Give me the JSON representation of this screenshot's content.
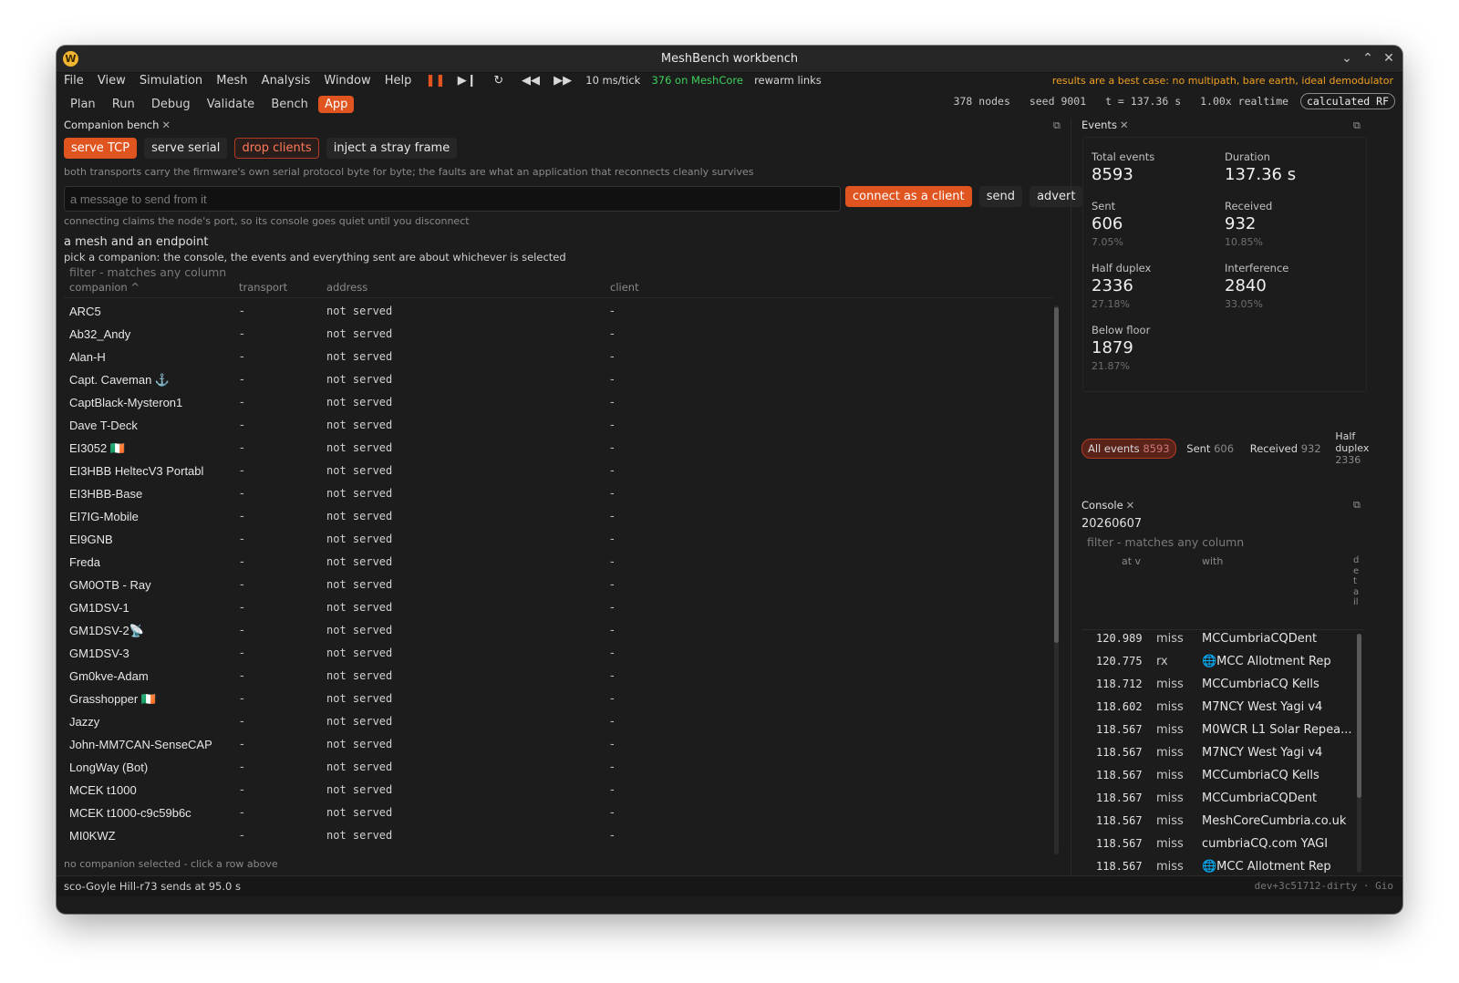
{
  "window": {
    "title": "MeshBench workbench",
    "logo": "W"
  },
  "menu": [
    "File",
    "View",
    "Simulation",
    "Mesh",
    "Analysis",
    "Window",
    "Help"
  ],
  "transport": {
    "tick_rate": "10 ms/tick",
    "mesh_status": "376 on MeshCore",
    "rewarm": "rewarm links",
    "status_color": "#3ecf5a"
  },
  "warning": "results are a best case: no multipath, bare earth, ideal demodulator",
  "tabs": [
    "Plan",
    "Run",
    "Debug",
    "Validate",
    "Bench",
    "App"
  ],
  "active_tab": "App",
  "status": {
    "nodes": "378 nodes",
    "seed": "seed 9001",
    "time": "t = 137.36 s",
    "speed": "1.00x realtime",
    "mode": "calculated RF"
  },
  "companion": {
    "title": "Companion bench",
    "buttons": {
      "serve_tcp": "serve TCP",
      "serve_serial": "serve serial",
      "drop_clients": "drop clients",
      "inject": "inject a stray frame"
    },
    "hint1": "both transports carry the firmware's own serial protocol byte for byte; the faults are what an application that reconnects cleanly survives",
    "message_placeholder": "a message to send from it",
    "connect": "connect as a client",
    "send": "send",
    "advert": "advert",
    "hint2": "connecting claims the node's port, so its console goes quiet until you disconnect",
    "section_title": "a mesh and an endpoint",
    "section_hint": "pick a companion: the console, the events and everything sent are about whichever is selected",
    "filter_placeholder": "filter - matches any column",
    "columns": [
      "companion ^",
      "transport",
      "address",
      "client"
    ],
    "rows": [
      [
        "ARC5",
        "-",
        "not served",
        "-"
      ],
      [
        "Ab32_Andy",
        "-",
        "not served",
        "-"
      ],
      [
        "Alan-H",
        "-",
        "not served",
        "-"
      ],
      [
        "Capt. Caveman ⚓",
        "-",
        "not served",
        "-"
      ],
      [
        "CaptBlack-Mysteron1",
        "-",
        "not served",
        "-"
      ],
      [
        "Dave T-Deck",
        "-",
        "not served",
        "-"
      ],
      [
        "EI3052 🇮🇪",
        "-",
        "not served",
        "-"
      ],
      [
        "EI3HBB HeltecV3 Portabl",
        "-",
        "not served",
        "-"
      ],
      [
        "EI3HBB-Base",
        "-",
        "not served",
        "-"
      ],
      [
        "EI7IG-Mobile",
        "-",
        "not served",
        "-"
      ],
      [
        "EI9GNB",
        "-",
        "not served",
        "-"
      ],
      [
        "Freda",
        "-",
        "not served",
        "-"
      ],
      [
        "GM0OTB - Ray",
        "-",
        "not served",
        "-"
      ],
      [
        "GM1DSV-1",
        "-",
        "not served",
        "-"
      ],
      [
        "GM1DSV-2📡",
        "-",
        "not served",
        "-"
      ],
      [
        "GM1DSV-3",
        "-",
        "not served",
        "-"
      ],
      [
        "Gm0kve-Adam",
        "-",
        "not served",
        "-"
      ],
      [
        "Grasshopper 🇮🇪",
        "-",
        "not served",
        "-"
      ],
      [
        "Jazzy",
        "-",
        "not served",
        "-"
      ],
      [
        "John-MM7CAN-SenseCAP",
        "-",
        "not served",
        "-"
      ],
      [
        "LongWay (Bot)",
        "-",
        "not served",
        "-"
      ],
      [
        "MCEK t1000",
        "-",
        "not served",
        "-"
      ],
      [
        "MCEK t1000-c9c59b6c",
        "-",
        "not served",
        "-"
      ],
      [
        "MI0KWZ",
        "-",
        "not served",
        "-"
      ]
    ],
    "footer_hint": "no companion selected - click a row above"
  },
  "events": {
    "title": "Events",
    "stats": [
      {
        "label": "Total events",
        "value": "8593",
        "pct": ""
      },
      {
        "label": "Duration",
        "value": "137.36 s",
        "pct": ""
      },
      {
        "label": "Sent",
        "value": "606",
        "pct": "7.05%"
      },
      {
        "label": "Received",
        "value": "932",
        "pct": "10.85%"
      },
      {
        "label": "Half duplex",
        "value": "2336",
        "pct": "27.18%"
      },
      {
        "label": "Interference",
        "value": "2840",
        "pct": "33.05%"
      },
      {
        "label": "Below floor",
        "value": "1879",
        "pct": "21.87%"
      }
    ],
    "chips": [
      {
        "label": "All events",
        "count": "8593"
      },
      {
        "label": "Sent",
        "count": "606"
      },
      {
        "label": "Received",
        "count": "932"
      },
      {
        "label": "Half duplex",
        "count": "2336"
      }
    ]
  },
  "console": {
    "title": "Console",
    "date": "20260607",
    "filter_placeholder": "filter - matches any column",
    "columns": [
      "at v",
      "with",
      "detail"
    ],
    "rows": [
      [
        "120.989",
        "miss",
        "MCCumbriaCQDent"
      ],
      [
        "120.775",
        "rx",
        "🌐MCC Allotment Rep"
      ],
      [
        "118.712",
        "miss",
        "MCCumbriaCQ Kells"
      ],
      [
        "118.602",
        "miss",
        "M7NCY West Yagi v4"
      ],
      [
        "118.567",
        "miss",
        "M0WCR L1 Solar Repea..."
      ],
      [
        "118.567",
        "miss",
        "M7NCY West Yagi v4"
      ],
      [
        "118.567",
        "miss",
        "MCCumbriaCQ Kells"
      ],
      [
        "118.567",
        "miss",
        "MCCumbriaCQDent"
      ],
      [
        "118.567",
        "miss",
        "MeshCoreCumbria.co.uk"
      ],
      [
        "118.567",
        "miss",
        "cumbriaCQ.com YAGI"
      ],
      [
        "118.567",
        "miss",
        "🌐MCC Allotment Rep"
      ]
    ]
  },
  "footer": {
    "left": "sco-Goyle Hill-r73 sends at 95.0 s",
    "right": "dev+3c51712-dirty · Gio"
  },
  "colors": {
    "accent": "#e0541f",
    "warning": "#f0a020",
    "ok": "#3ecf5a"
  }
}
